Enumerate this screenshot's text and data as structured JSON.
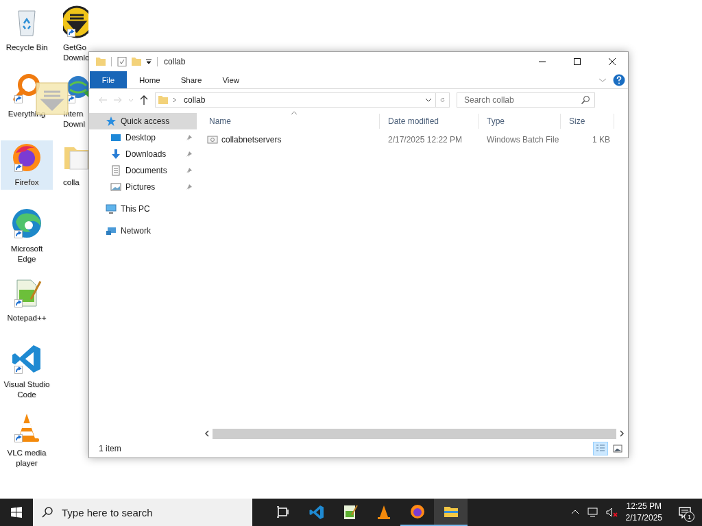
{
  "desktop_icons": [
    {
      "label": "Recycle Bin",
      "kind": "recycle",
      "shortcut": false,
      "selected": false
    },
    {
      "label": "GetGo Downlo",
      "kind": "getgo",
      "shortcut": true,
      "selected": false
    },
    {
      "label": "Everything",
      "kind": "everything",
      "shortcut": true,
      "selected": false
    },
    {
      "label": "Intern Downl",
      "kind": "idm",
      "shortcut": true,
      "selected": false
    },
    {
      "label": "Firefox",
      "kind": "firefox",
      "shortcut": true,
      "selected": true
    },
    {
      "label": "colla",
      "kind": "folder",
      "shortcut": false,
      "selected": false
    },
    {
      "label": "Microsoft Edge",
      "kind": "edge",
      "shortcut": true,
      "selected": false
    },
    {
      "label": "Notepad++",
      "kind": "notepad",
      "shortcut": true,
      "selected": false
    },
    {
      "label": "Visual Studio Code",
      "kind": "vscode",
      "shortcut": true,
      "selected": false
    },
    {
      "label": "VLC media player",
      "kind": "vlc",
      "shortcut": true,
      "selected": false
    }
  ],
  "window": {
    "title": "collab",
    "ribbon_tabs": [
      {
        "label": "File",
        "kind": "file",
        "selected": false
      },
      {
        "label": "Home",
        "kind": "tab",
        "selected": false
      },
      {
        "label": "Share",
        "kind": "tab",
        "selected": false
      },
      {
        "label": "View",
        "kind": "tab",
        "selected": false
      }
    ],
    "address": {
      "path": "collab"
    },
    "search": {
      "placeholder": "Search collab"
    },
    "nav": [
      {
        "label": "Quick access",
        "kind": "star",
        "selected": true,
        "children": [
          {
            "label": "Desktop",
            "kind": "desktop",
            "selected": false,
            "pinned": true
          },
          {
            "label": "Downloads",
            "kind": "downloads",
            "selected": false,
            "pinned": true
          },
          {
            "label": "Documents",
            "kind": "documents",
            "selected": false,
            "pinned": true
          },
          {
            "label": "Pictures",
            "kind": "pictures",
            "selected": false,
            "pinned": true
          }
        ]
      },
      {
        "label": "This PC",
        "kind": "pc",
        "selected": false
      },
      {
        "label": "Network",
        "kind": "network",
        "selected": false
      }
    ],
    "columns": [
      "Name",
      "Date modified",
      "Type",
      "Size"
    ],
    "files": [
      {
        "name": "collabnetservers",
        "date": "2/17/2025 12:22 PM",
        "type": "Windows Batch File",
        "size": "1 KB"
      }
    ],
    "status": "1 item",
    "view_buttons": [
      {
        "kind": "details",
        "selected": true
      },
      {
        "kind": "large",
        "selected": false
      }
    ]
  },
  "taskbar": {
    "search_placeholder": "Type here to search",
    "apps": [
      {
        "kind": "taskview",
        "running": false,
        "selected": false
      },
      {
        "kind": "vscode",
        "running": false,
        "selected": false
      },
      {
        "kind": "notepad",
        "running": false,
        "selected": false
      },
      {
        "kind": "vlc",
        "running": false,
        "selected": false
      },
      {
        "kind": "firefox",
        "running": true,
        "selected": false
      },
      {
        "kind": "explorer",
        "running": true,
        "selected": true
      }
    ],
    "time": "12:25 PM",
    "date": "2/17/2025",
    "notifications": "1"
  }
}
